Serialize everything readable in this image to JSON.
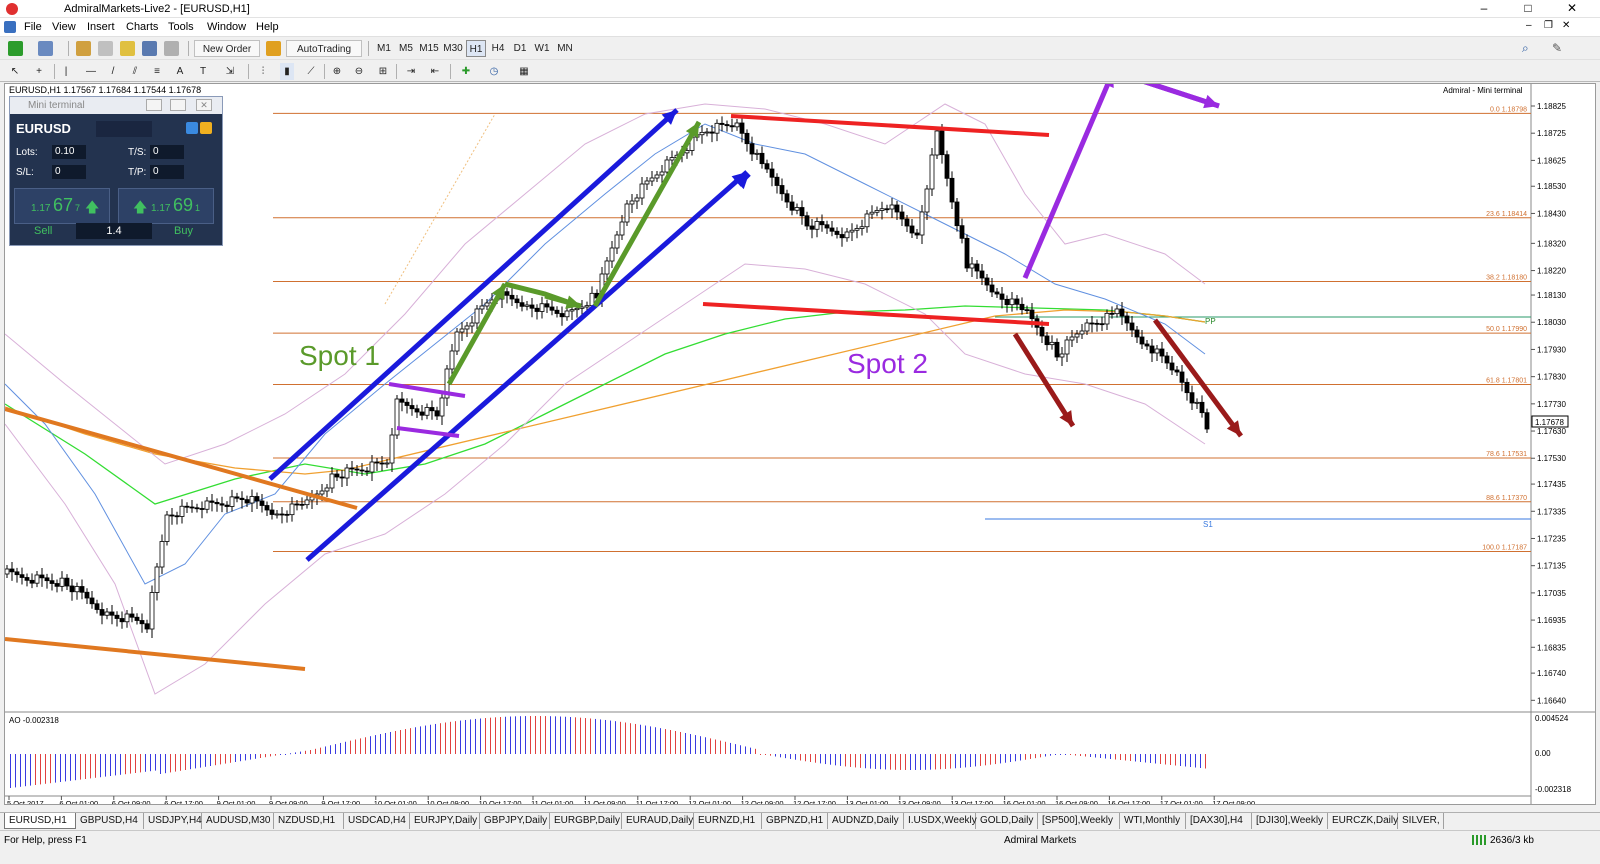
{
  "window": {
    "title": "AdmiralMarkets-Live2 - [EURUSD,H1]",
    "minimize": "–",
    "maximize": "□",
    "close": "✕"
  },
  "menu": [
    "File",
    "View",
    "Insert",
    "Charts",
    "Tools",
    "Window",
    "Help"
  ],
  "toolbar": {
    "new_order": "New Order",
    "auto_trading": "AutoTrading",
    "timeframes": [
      "M1",
      "M5",
      "M15",
      "M30",
      "H1",
      "H4",
      "D1",
      "W1",
      "MN"
    ]
  },
  "chart": {
    "header": "EURUSD,H1  1.17567 1.17684 1.17544 1.17678",
    "corner_label": "Admiral - Mini terminal",
    "price_axis": [
      "1.18825",
      "1.18725",
      "1.18625",
      "1.18530",
      "1.18430",
      "1.18320",
      "1.18220",
      "1.18130",
      "1.18030",
      "1.17930",
      "1.17830",
      "1.17730",
      "1.17630",
      "1.17530",
      "1.17435",
      "1.17335",
      "1.17235",
      "1.17135",
      "1.17035",
      "1.16935",
      "1.16835",
      "1.16740",
      "1.16640"
    ],
    "current_price": "1.17678",
    "fib_labels": [
      "0.0 1.18798",
      "23.6 1.18414",
      "38.2 1.18180",
      "50.0 1.17990",
      "61.8 1.17801",
      "78.6 1.17531",
      "88.6 1.17370",
      "100.0 1.17187"
    ],
    "pp_label": "PP",
    "s1_label": "S1",
    "time_axis": [
      "5 Oct 2017",
      "6 Oct 01:00",
      "6 Oct 09:00",
      "6 Oct 17:00",
      "9 Oct 01:00",
      "9 Oct 09:00",
      "9 Oct 17:00",
      "10 Oct 01:00",
      "10 Oct 09:00",
      "10 Oct 17:00",
      "11 Oct 01:00",
      "11 Oct 09:00",
      "11 Oct 17:00",
      "12 Oct 01:00",
      "12 Oct 09:00",
      "12 Oct 17:00",
      "13 Oct 01:00",
      "13 Oct 09:00",
      "13 Oct 17:00",
      "16 Oct 01:00",
      "16 Oct 09:00",
      "16 Oct 17:00",
      "17 Oct 01:00",
      "17 Oct 09:00"
    ],
    "annotation_spot1": "Spot 1",
    "annotation_spot2": "Spot 2",
    "colors": {
      "up_arrow": "#1a1adc",
      "zigzag": "#5a9a2a",
      "red_line": "#ee2222",
      "purple": "#9a2ae0",
      "dark_red": "#9a1a1a",
      "orange_line": "#e07820",
      "fib": "#d07030",
      "ma_green": "#33dd33",
      "ma_orange": "#f0a030",
      "s1_blue": "#3a7ae0"
    }
  },
  "indicator": {
    "label": "AO -0.002318",
    "scale": [
      "0.004524",
      "0.00",
      "-0.002318"
    ]
  },
  "mini_terminal": {
    "title": "Mini terminal",
    "symbol": "EURUSD",
    "lots_label": "Lots:",
    "lots_value": "0.10",
    "sl_label": "S/L:",
    "sl_value": "0",
    "ts_label": "T/S:",
    "ts_value": "0",
    "tp_label": "T/P:",
    "tp_value": "0",
    "sell_price_small": "1.17",
    "sell_price_big": "67",
    "sell_price_tail": "7",
    "buy_price_small": "1.17",
    "buy_price_big": "69",
    "buy_price_tail": "1",
    "sell_label": "Sell",
    "buy_label": "Buy",
    "spread": "1.4"
  },
  "tabs": [
    "EURUSD,H1",
    "GBPUSD,H4",
    "USDJPY,H4",
    "AUDUSD,M30",
    "NZDUSD,H1",
    "USDCAD,H4",
    "EURJPY,Daily",
    "GBPJPY,Daily",
    "EURGBP,Daily",
    "EURAUD,Daily",
    "EURNZD,H1",
    "GBPNZD,H1",
    "AUDNZD,Daily",
    "I.USDX,Weekly",
    "GOLD,Daily",
    "[SP500],Weekly",
    "WTI,Monthly",
    "[DAX30],H4",
    "[DJI30],Weekly",
    "EURCZK,Daily",
    "SILVER,"
  ],
  "status": {
    "help": "For Help, press F1",
    "profile": "Admiral Markets",
    "traffic": "2636/3 kb"
  }
}
